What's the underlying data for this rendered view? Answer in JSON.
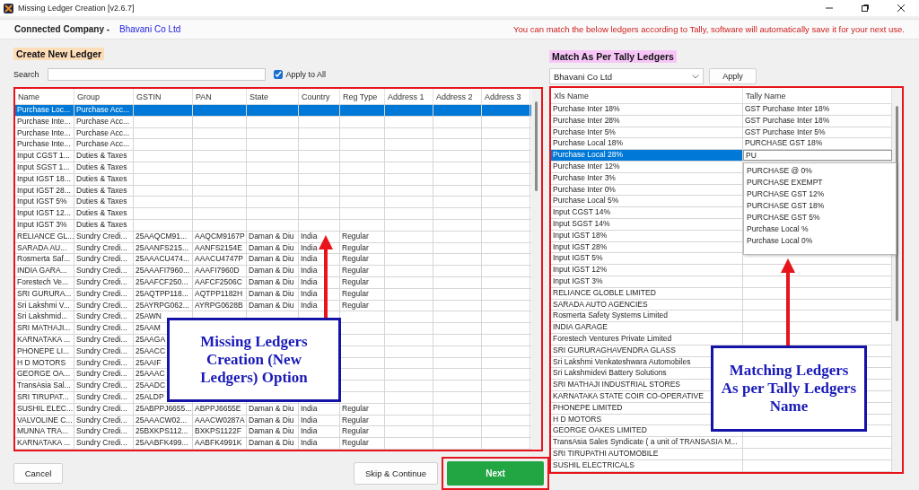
{
  "window": {
    "title": "Missing Ledger Creation [v2.6.7]"
  },
  "header": {
    "label": "Connected Company -",
    "company": "Bhavani Co Ltd",
    "notice": "You can match the below ledgers according to Tally, software will automatically save it for your next use."
  },
  "create_panel": {
    "title": "Create New Ledger",
    "search": {
      "label": "Search"
    },
    "apply_all": {
      "label": "Apply to All",
      "checked": true
    },
    "table": {
      "columns": [
        "Name",
        "Group",
        "GSTIN",
        "PAN",
        "State",
        "Country",
        "Reg Type",
        "Address 1",
        "Address 2",
        "Address 3"
      ],
      "rows": [
        {
          "cells": [
            "Purchase Loc...",
            "Purchase Acc..."
          ],
          "selected": true
        },
        {
          "cells": [
            "Purchase Inte...",
            "Purchase Acc..."
          ],
          "selected": false
        },
        {
          "cells": [
            "Purchase Inte...",
            "Purchase Acc..."
          ],
          "selected": false
        },
        {
          "cells": [
            "Purchase Inte...",
            "Purchase Acc..."
          ],
          "selected": false
        },
        {
          "cells": [
            "Input CGST 1...",
            "Duties & Taxes"
          ],
          "selected": false
        },
        {
          "cells": [
            "Input SGST 1...",
            "Duties & Taxes"
          ],
          "selected": false
        },
        {
          "cells": [
            "Input IGST 18...",
            "Duties & Taxes"
          ],
          "selected": false
        },
        {
          "cells": [
            "Input IGST 28...",
            "Duties & Taxes"
          ],
          "selected": false
        },
        {
          "cells": [
            "Input IGST 5%",
            "Duties & Taxes"
          ],
          "selected": false
        },
        {
          "cells": [
            "Input IGST 12...",
            "Duties & Taxes"
          ],
          "selected": false
        },
        {
          "cells": [
            "Input IGST 3%",
            "Duties & Taxes"
          ],
          "selected": false
        },
        {
          "cells": [
            "RELIANCE GL...",
            "Sundry Credi...",
            "25AAQCM91...",
            "AAQCM9167P",
            "Daman & Diu",
            "India",
            "Regular"
          ],
          "selected": false
        },
        {
          "cells": [
            "SARADA AU...",
            "Sundry Credi...",
            "25AANFS215...",
            "AANFS2154E",
            "Daman & Diu",
            "India",
            "Regular"
          ],
          "selected": false
        },
        {
          "cells": [
            "Rosmerta Saf...",
            "Sundry Credi...",
            "25AAACU474...",
            "AAACU4747P",
            "Daman & Diu",
            "India",
            "Regular"
          ],
          "selected": false
        },
        {
          "cells": [
            "INDIA GARA...",
            "Sundry Credi...",
            "25AAAFI7960...",
            "AAAFI7960D",
            "Daman & Diu",
            "India",
            "Regular"
          ],
          "selected": false
        },
        {
          "cells": [
            "Forestech Ve...",
            "Sundry Credi...",
            "25AAFCF250...",
            "AAFCF2506C",
            "Daman & Diu",
            "India",
            "Regular"
          ],
          "selected": false
        },
        {
          "cells": [
            "SRI GURURA...",
            "Sundry Credi...",
            "25AQTPP118...",
            "AQTPP1182H",
            "Daman & Diu",
            "India",
            "Regular"
          ],
          "selected": false
        },
        {
          "cells": [
            "Sri Lakshmi V...",
            "Sundry Credi...",
            "25AYRPG062...",
            "AYRPG0628B",
            "Daman & Diu",
            "India",
            "Regular"
          ],
          "selected": false
        },
        {
          "cells": [
            "Sri Lakshmid...",
            "Sundry Credi...",
            "25AWN"
          ],
          "selected": false
        },
        {
          "cells": [
            "SRI MATHAJI...",
            "Sundry Credi...",
            "25AAM"
          ],
          "selected": false
        },
        {
          "cells": [
            "KARNATAKA ...",
            "Sundry Credi...",
            "25AAGA"
          ],
          "selected": false
        },
        {
          "cells": [
            "PHONEPE LI...",
            "Sundry Credi...",
            "25AACC"
          ],
          "selected": false
        },
        {
          "cells": [
            "H D MOTORS",
            "Sundry Credi...",
            "25AAIF"
          ],
          "selected": false
        },
        {
          "cells": [
            "GEORGE OA...",
            "Sundry Credi...",
            "25AAAC"
          ],
          "selected": false
        },
        {
          "cells": [
            "TransAsia Sal...",
            "Sundry Credi...",
            "25AADC"
          ],
          "selected": false
        },
        {
          "cells": [
            "SRI TIRUPAT...",
            "Sundry Credi...",
            "25ALDP"
          ],
          "selected": false
        },
        {
          "cells": [
            "SUSHIL ELEC...",
            "Sundry Credi...",
            "25ABPPJ6655...",
            "ABPPJ6655E",
            "Daman & Diu",
            "India",
            "Regular"
          ],
          "selected": false
        },
        {
          "cells": [
            "VALVOLINE C...",
            "Sundry Credi...",
            "25AAACW02...",
            "AAACW0287A",
            "Daman & Diu",
            "India",
            "Regular"
          ],
          "selected": false
        },
        {
          "cells": [
            "MUNNA TRA...",
            "Sundry Credi...",
            "25BXKPS112...",
            "BXKPS1122F",
            "Daman & Diu",
            "India",
            "Regular"
          ],
          "selected": false
        },
        {
          "cells": [
            "KARNATAKA ...",
            "Sundry Credi...",
            "25AABFK499...",
            "AABFK4991K",
            "Daman & Diu",
            "India",
            "Regular"
          ],
          "selected": false
        }
      ]
    }
  },
  "match_panel": {
    "title": "Match As Per Tally Ledgers",
    "company_select": {
      "value": "Bhavani Co Ltd"
    },
    "apply_button": "Apply",
    "table": {
      "columns": [
        "Xls Name",
        "Tally Name"
      ],
      "rows": [
        {
          "xls_name": "Purchase Inter 18%",
          "tally_name": "GST Purchase Inter 18%",
          "selected": false
        },
        {
          "xls_name": "Purchase Inter 28%",
          "tally_name": "GST Purchase Inter 18%",
          "selected": false
        },
        {
          "xls_name": "Purchase Inter 5%",
          "tally_name": "GST Purchase Inter 5%",
          "selected": false
        },
        {
          "xls_name": "Purchase Local 18%",
          "tally_name": "PURCHASE GST 18%",
          "selected": false
        },
        {
          "xls_name": "Purchase Local 28%",
          "selected": true
        },
        {
          "xls_name": "Purchase Inter 12%",
          "selected": false
        },
        {
          "xls_name": "Purchase Inter 3%",
          "selected": false
        },
        {
          "xls_name": "Purchase Inter 0%",
          "selected": false
        },
        {
          "xls_name": "Purchase Local 5%",
          "selected": false
        },
        {
          "xls_name": "Input CGST 14%",
          "selected": false
        },
        {
          "xls_name": "Input SGST 14%",
          "selected": false
        },
        {
          "xls_name": "Input IGST 18%",
          "selected": false
        },
        {
          "xls_name": "Input IGST 28%",
          "selected": false
        },
        {
          "xls_name": "Input IGST 5%",
          "selected": false
        },
        {
          "xls_name": "Input IGST 12%",
          "selected": false
        },
        {
          "xls_name": "Input IGST 3%",
          "selected": false
        },
        {
          "xls_name": "RELIANCE GLOBLE LIMITED",
          "selected": false
        },
        {
          "xls_name": "SARADA AUTO AGENCIES",
          "selected": false
        },
        {
          "xls_name": "Rosmerta Safety Systems Limited",
          "selected": false
        },
        {
          "xls_name": "INDIA GARAGE",
          "selected": false
        },
        {
          "xls_name": "Forestech Ventures Private Limited",
          "selected": false
        },
        {
          "xls_name": "SRI GURURAGHAVENDRA GLASS",
          "selected": false
        },
        {
          "xls_name": "Sri Lakshmi Venkateshwara Automobiles",
          "selected": false
        },
        {
          "xls_name": "Sri Lakshmidevi Battery Solutions",
          "selected": false
        },
        {
          "xls_name": "SRI MATHAJI INDUSTRIAL STORES",
          "selected": false
        },
        {
          "xls_name": "KARNATAKA STATE COIR CO-OPERATIVE",
          "selected": false
        },
        {
          "xls_name": "PHONEPE LIMITED",
          "selected": false
        },
        {
          "xls_name": "H D MOTORS",
          "selected": false
        },
        {
          "xls_name": "GEORGE OAKES LIMITED",
          "selected": false
        },
        {
          "xls_name": "TransAsia Sales Syndicate ( a unit of TRANSASIA M...",
          "selected": false
        },
        {
          "xls_name": "SRI TIRUPATHI AUTOMOBILE",
          "selected": false
        },
        {
          "xls_name": "SUSHIL ELECTRICALS",
          "selected": false
        }
      ],
      "editor": {
        "value": "PU"
      },
      "suggestions": [
        "PURCHASE @ 0%",
        "PURCHASE EXEMPT",
        "PURCHASE GST 12%",
        "PURCHASE GST 18%",
        "PURCHASE GST 5%",
        "Purchase Local %",
        "Purchase Local 0%"
      ]
    }
  },
  "buttons": {
    "cancel": "Cancel",
    "skip": "Skip & Continue",
    "next": "Next"
  },
  "annotations": [
    {
      "text": "Missing Ledgers Creation (New Ledgers) Option"
    },
    {
      "text": "Matching Ledgers As per Tally Ledgers Name"
    }
  ]
}
